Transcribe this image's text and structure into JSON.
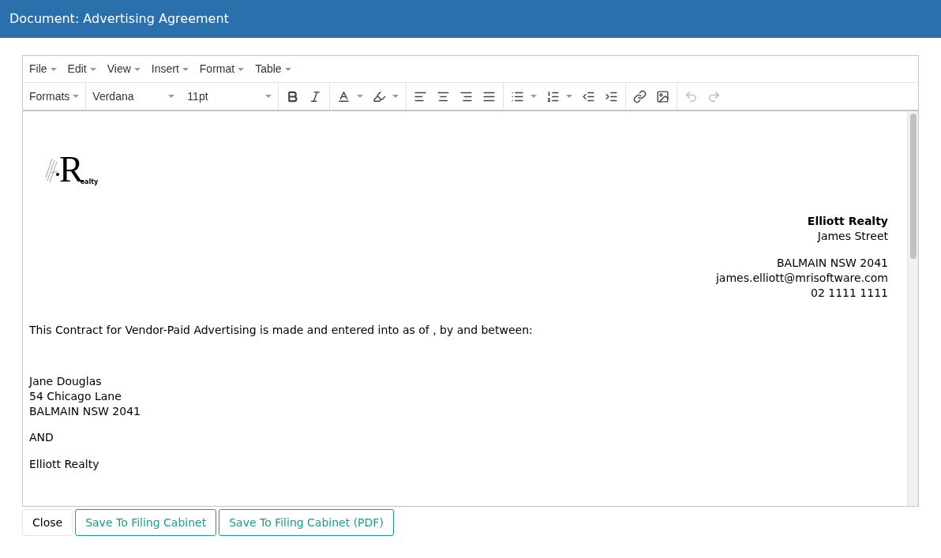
{
  "window": {
    "title": "Document: Advertising Agreement"
  },
  "menu": [
    "File",
    "Edit",
    "View",
    "Insert",
    "Format",
    "Table"
  ],
  "toolbar": {
    "formats": "Formats",
    "font": "Verdana",
    "size": "11pt",
    "groups": [
      [
        {
          "kind": "bold",
          "dropdown": false,
          "disabled": false
        },
        {
          "kind": "italic",
          "dropdown": false,
          "disabled": false
        }
      ],
      [
        {
          "kind": "text-color",
          "dropdown": true,
          "disabled": false
        },
        {
          "kind": "highlight",
          "dropdown": true,
          "disabled": false
        }
      ],
      [
        {
          "kind": "align-left",
          "dropdown": false,
          "disabled": false
        },
        {
          "kind": "align-center",
          "dropdown": false,
          "disabled": false
        },
        {
          "kind": "align-right",
          "dropdown": false,
          "disabled": false
        },
        {
          "kind": "justify",
          "dropdown": false,
          "disabled": false
        }
      ],
      [
        {
          "kind": "bullets",
          "dropdown": true,
          "disabled": false
        },
        {
          "kind": "numbering",
          "dropdown": true,
          "disabled": false
        },
        {
          "kind": "outdent",
          "dropdown": false,
          "disabled": false
        },
        {
          "kind": "indent",
          "dropdown": false,
          "disabled": false
        }
      ],
      [
        {
          "kind": "link",
          "dropdown": false,
          "disabled": false
        },
        {
          "kind": "image",
          "dropdown": false,
          "disabled": false
        }
      ],
      [
        {
          "kind": "undo",
          "dropdown": false,
          "disabled": true
        },
        {
          "kind": "redo",
          "dropdown": false,
          "disabled": true
        }
      ]
    ]
  },
  "document": {
    "logo": {
      "initial": "R",
      "text": "ealty"
    },
    "sender": [
      [
        {
          "text": "Elliott Realty",
          "bold": true
        },
        {
          "text": "James Street",
          "bold": false
        }
      ],
      [
        {
          "text": "BALMAIN NSW 2041",
          "bold": false
        },
        {
          "text": "james.elliott@mrisoftware.com",
          "bold": false
        },
        {
          "text": "02 1111 1111",
          "bold": false
        }
      ]
    ],
    "intro": "This Contract for Vendor-Paid Advertising is made and entered into as of , by and between:",
    "party": [
      "Jane Douglas",
      "54 Chicago Lane",
      "BALMAIN NSW 2041"
    ],
    "conjunction": "AND",
    "agent": "Elliott Realty"
  },
  "buttons": [
    {
      "label": "Close",
      "kind": "plain"
    },
    {
      "label": "Save To Filing Cabinet",
      "kind": "outline"
    },
    {
      "label": "Save To Filing Cabinet (PDF)",
      "kind": "outline"
    }
  ]
}
